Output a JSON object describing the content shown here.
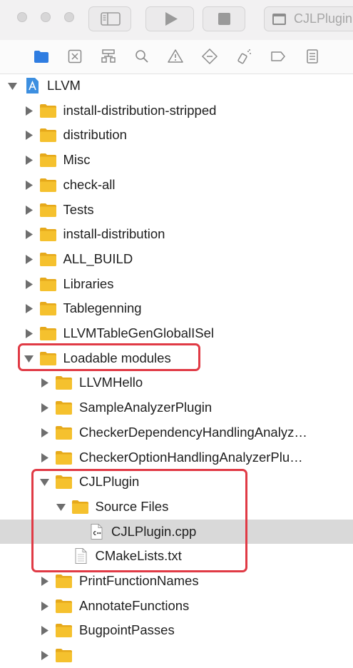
{
  "toolbar": {
    "scheme_label": "CJLPlugin"
  },
  "navigator": {
    "icons": [
      "folder-icon",
      "source-control-icon",
      "hierarchy-icon",
      "search-icon",
      "warning-icon",
      "test-diamond-icon",
      "debug-spray-icon",
      "breakpoint-icon",
      "report-icon"
    ],
    "active_icon": "folder-icon"
  },
  "tree": {
    "rows": [
      {
        "label": "LLVM",
        "level": 0,
        "type": "project",
        "disclosure": "open"
      },
      {
        "label": "install-distribution-stripped",
        "level": 1,
        "type": "folder",
        "disclosure": "closed"
      },
      {
        "label": "distribution",
        "level": 1,
        "type": "folder",
        "disclosure": "closed"
      },
      {
        "label": "Misc",
        "level": 1,
        "type": "folder",
        "disclosure": "closed"
      },
      {
        "label": "check-all",
        "level": 1,
        "type": "folder",
        "disclosure": "closed"
      },
      {
        "label": "Tests",
        "level": 1,
        "type": "folder",
        "disclosure": "closed"
      },
      {
        "label": "install-distribution",
        "level": 1,
        "type": "folder",
        "disclosure": "closed"
      },
      {
        "label": "ALL_BUILD",
        "level": 1,
        "type": "folder",
        "disclosure": "closed"
      },
      {
        "label": "Libraries",
        "level": 1,
        "type": "folder",
        "disclosure": "closed"
      },
      {
        "label": "Tablegenning",
        "level": 1,
        "type": "folder",
        "disclosure": "closed"
      },
      {
        "label": "LLVMTableGenGlobalISel",
        "level": 1,
        "type": "folder",
        "disclosure": "closed"
      },
      {
        "label": "Loadable modules",
        "level": 1,
        "type": "folder",
        "disclosure": "open"
      },
      {
        "label": "LLVMHello",
        "level": 2,
        "type": "folder",
        "disclosure": "closed"
      },
      {
        "label": "SampleAnalyzerPlugin",
        "level": 2,
        "type": "folder",
        "disclosure": "closed"
      },
      {
        "label": "CheckerDependencyHandlingAnalyz…",
        "level": 2,
        "type": "folder",
        "disclosure": "closed"
      },
      {
        "label": "CheckerOptionHandlingAnalyzerPlu…",
        "level": 2,
        "type": "folder",
        "disclosure": "closed"
      },
      {
        "label": "CJLPlugin",
        "level": 2,
        "type": "folder",
        "disclosure": "open"
      },
      {
        "label": "Source Files",
        "level": 3,
        "type": "folder",
        "disclosure": "open"
      },
      {
        "label": "CJLPlugin.cpp",
        "level": 4,
        "type": "cpp",
        "disclosure": "none",
        "selected": true
      },
      {
        "label": "CMakeLists.txt",
        "level": 3,
        "type": "text",
        "disclosure": "none"
      },
      {
        "label": "PrintFunctionNames",
        "level": 2,
        "type": "folder",
        "disclosure": "closed"
      },
      {
        "label": "AnnotateFunctions",
        "level": 2,
        "type": "folder",
        "disclosure": "closed"
      },
      {
        "label": "BugpointPasses",
        "level": 2,
        "type": "folder",
        "disclosure": "closed"
      },
      {
        "label": "",
        "level": 2,
        "type": "folder",
        "disclosure": "closed"
      }
    ]
  },
  "colors": {
    "folder": "#f5c12e",
    "highlight": "#e03a45",
    "selection": "#d9d9d9",
    "project_icon": "#3d8fe0",
    "active_nav": "#2f7de1"
  }
}
